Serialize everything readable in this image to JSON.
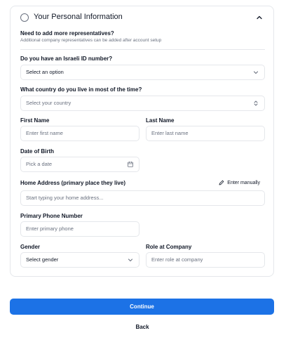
{
  "section": {
    "title": "Your Personal Information",
    "notice_title": "Need to add more representatives?",
    "notice_sub": "Additional company representatives can be added after account setup"
  },
  "israeli_id": {
    "label": "Do you have an Israeli ID number?",
    "value": "Select an option"
  },
  "country": {
    "label": "What country do you live in most of the time?",
    "placeholder": "Select your country"
  },
  "first_name": {
    "label": "First Name",
    "placeholder": "Enter first name"
  },
  "last_name": {
    "label": "Last Name",
    "placeholder": "Enter last name"
  },
  "dob": {
    "label": "Date of Birth",
    "placeholder": "Pick a date"
  },
  "address": {
    "label": "Home Address  (primary place they live)",
    "placeholder": "Start typing your home address...",
    "manual_label": "Enter manually"
  },
  "phone": {
    "label": "Primary Phone Number",
    "placeholder": "Enter primary phone"
  },
  "gender": {
    "label": "Gender",
    "value": "Select gender"
  },
  "role": {
    "label": "Role at Company",
    "placeholder": "Enter role at company"
  },
  "actions": {
    "continue": "Continue",
    "back": "Back"
  },
  "colors": {
    "primary": "#1c72e6",
    "border": "#e5e7eb",
    "muted": "#6b7280"
  }
}
